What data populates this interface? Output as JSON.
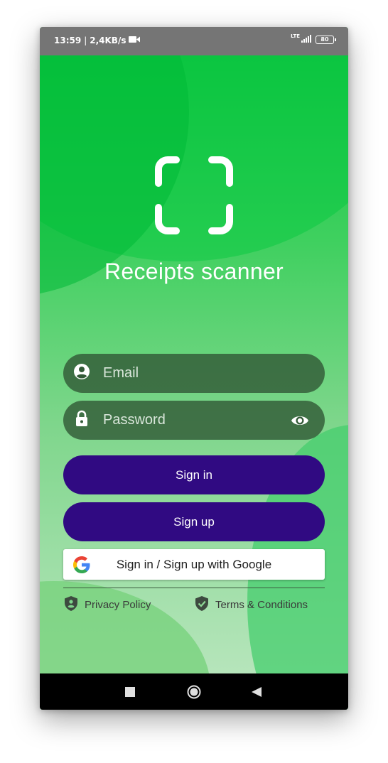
{
  "status_bar": {
    "time": "13:59",
    "separator": "|",
    "network_speed": "2,4KB/s",
    "network_type": "LTE",
    "battery_level": "80",
    "icons": [
      "video-camera-icon",
      "signal-icon",
      "battery-icon"
    ]
  },
  "app": {
    "logo_icon": "scan-frame-icon",
    "title": "Receipts scanner",
    "email": {
      "placeholder": "Email",
      "value": "",
      "icon": "account-circle-icon"
    },
    "password": {
      "placeholder": "Password",
      "value": "",
      "icon": "lock-icon",
      "toggle_icon": "eye-icon"
    },
    "sign_in_label": "Sign in",
    "sign_up_label": "Sign up",
    "google_label": "Sign in / Sign up with Google",
    "privacy_label": "Privacy Policy",
    "terms_label": "Terms & Conditions"
  },
  "nav_bar": {
    "items": [
      "recent-apps-icon",
      "home-icon",
      "back-icon"
    ]
  },
  "colors": {
    "accent_green": "#14c444",
    "button_purple": "#300a82",
    "field_bg": "#325a37",
    "status_bar": "#757575",
    "nav_bar": "#000000"
  }
}
